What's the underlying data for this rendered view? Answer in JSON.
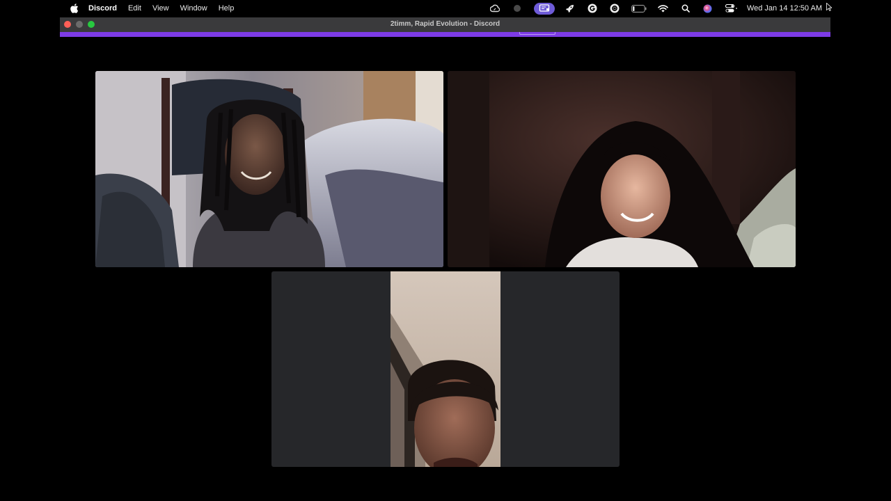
{
  "menubar": {
    "app_name": "Discord",
    "menus": [
      "Edit",
      "View",
      "Window",
      "Help"
    ],
    "clock": "Wed Jan 14  12:50 AM",
    "status_icons": [
      "creative-cloud-icon",
      "record-dot-icon",
      "screen-share-icon",
      "rocket-icon",
      "grammarly-icon",
      "openai-icon",
      "battery-icon",
      "wifi-icon",
      "search-icon",
      "siri-icon",
      "control-center-icon"
    ]
  },
  "window": {
    "title": "2timm, Rapid Evolution - Discord",
    "accent_color": "#7d3be6"
  },
  "call": {
    "participants": [
      {
        "tile": "participant-video-1",
        "camera": "on"
      },
      {
        "tile": "participant-video-2",
        "camera": "on"
      },
      {
        "tile": "participant-video-3",
        "camera": "on",
        "orientation": "portrait"
      }
    ]
  }
}
